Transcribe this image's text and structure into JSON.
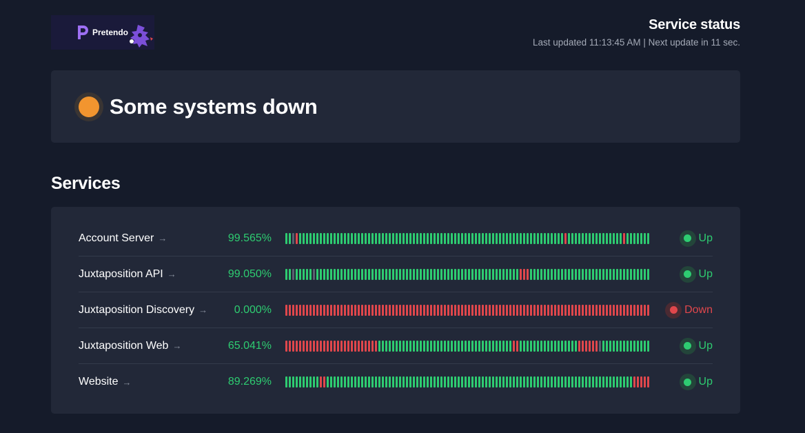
{
  "logo": {
    "text": "Pretendo"
  },
  "header": {
    "title": "Service status",
    "subtitle": "Last updated 11:13:45 AM | Next update in 11 sec."
  },
  "banner": {
    "text": "Some systems down",
    "color": "#f2952f"
  },
  "section_title": "Services",
  "colors": {
    "up": "#2ecc71",
    "down": "#e0474c",
    "unknown": "#596070"
  },
  "services": [
    {
      "name": "Account Server",
      "uptime": "99.565%",
      "status": "Up",
      "state": "up",
      "history": "uuxduuuuuuuuuuuuuuuuuuuuuuuuuuuuuuuuuuuuuuuuuuuuuuuuuuuuuuuuuuuuuuuuuuuuuuuuuuuuuduuuuuuuuuuuuuuuuduuuuuuuuuuuuuuuuuuuuuuuuuuuuuuuuuuuuuu"
    },
    {
      "name": "Juxtaposition API",
      "uptime": "99.050%",
      "status": "Up",
      "state": "up",
      "history": "uuxuuuuuxuuuuuuuuuuuuuuuuuuuuuuuuuuuuuuuuuuuuuuuuuuuuuuuuuuuuuuuuuuuddduuuuuuuuuuuuuuuuuuuuuuuuuuuuuuuuuuuuuuuuuuuuuuuuuuuuuuuuuuuuuuuu"
    },
    {
      "name": "Juxtaposition Discovery",
      "uptime": "0.000%",
      "status": "Down",
      "state": "down",
      "history": "dddddddddddddddddddddddddddddddddddddddddddddddddddddddddddddddddddddddddddddddddddddddddddddddddddddddddddddddddddddddddddddddddddddd"
    },
    {
      "name": "Juxtaposition Web",
      "uptime": "65.041%",
      "status": "Up",
      "state": "up",
      "history": "ddddddddddddddddddddddddddduuuuuuuuuuuuuuuuuuuuuuuuuuuuuuuuuuuuuuudduuuuuuuuuuuuuuuuuddddddxuuuuuuuuuuuuuuuuuuuuuuuuuuuuuuuuuuuuuuuuuuuuuu"
    },
    {
      "name": "Website",
      "uptime": "89.269%",
      "status": "Up",
      "state": "up",
      "history": "uuuuuuuuuudduuuuuuuuuuuuuuuuuuuuuuuuuuuuuuuuuuuuuuuuuuuuuuuuuuuuuuuuuuuuuuuuuuuuuuuuuuuuuuuuuuuuuuuuuddddddddddddddduuuuuuuuuuuuuuuuuuuuuuuuuuuuu"
    }
  ]
}
